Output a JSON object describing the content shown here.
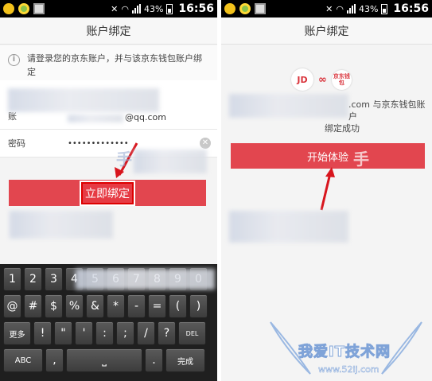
{
  "status_bar": {
    "battery": "43%",
    "time": "16:56"
  },
  "left_screen": {
    "title": "账户绑定",
    "notice": "请登录您的京东账户，并与该京东钱包账户绑定",
    "account_label": "账",
    "account_value": "@qq.com",
    "password_label": "密码",
    "password_value": "•••••••••••••",
    "clear_icon": "close-icon",
    "bind_button": "立即绑定",
    "keyboard": {
      "row1": [
        "1",
        "2",
        "3",
        "4",
        "5",
        "6",
        "7",
        "8",
        "9",
        "0"
      ],
      "row2": [
        "@",
        "#",
        "$",
        "%",
        "&",
        "*",
        "-",
        "=",
        "(",
        ")"
      ],
      "row3": [
        "更多",
        "!",
        "\"",
        "'",
        ":",
        ";",
        "/",
        "?",
        "DEL"
      ],
      "row4": [
        "ABC",
        ",",
        "",
        ".",
        "完成"
      ]
    }
  },
  "right_screen": {
    "title": "账户绑定",
    "logo_jd": "JD",
    "logo_wallet": "京东钱包",
    "success_line1": ".com 与京东钱包账户",
    "success_line2": "绑定成功",
    "start_button": "开始体验"
  },
  "watermark": {
    "brand": "我爱IT技术网",
    "url": "www.52ij.com",
    "hand_text": "手"
  }
}
